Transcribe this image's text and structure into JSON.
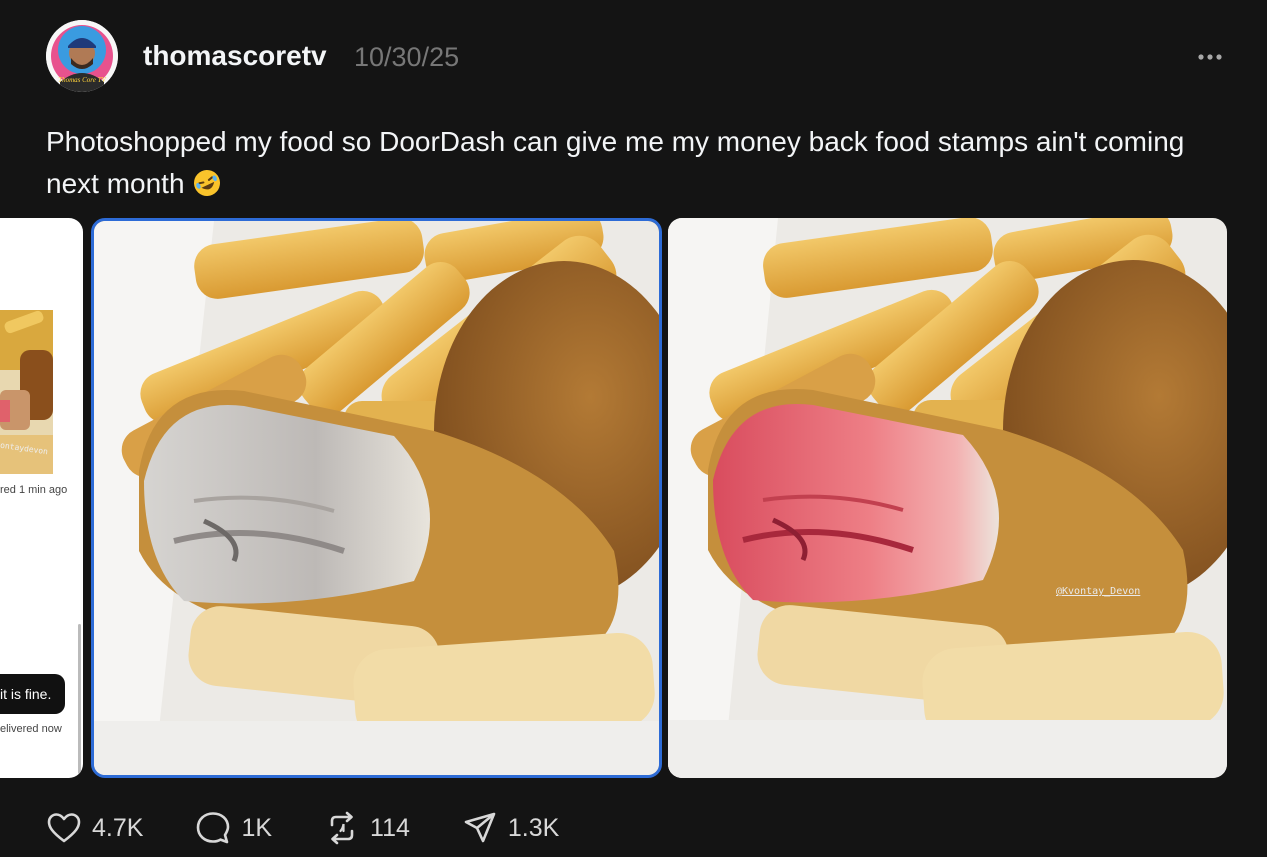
{
  "post": {
    "username": "thomascoretv",
    "timestamp": "10/30/25",
    "caption": "Photoshopped my food so DoorDash can give me my money back food stamps ain't coming next month",
    "caption_emoji": "rolling-on-the-floor-laughing-emoji",
    "avatar_text": "Thomas Core TV",
    "menu_icon": "more-options-icon"
  },
  "media": {
    "screenshot_card": {
      "meta_text": "red 1 min ago",
      "bubble_text": "it is fine.",
      "status_text": "elivered now",
      "watermark": "ontaydevon"
    },
    "edited_photo": {
      "watermark": "@Kvontay_Devon"
    },
    "selected_index": 1
  },
  "actions": {
    "likes": "4.7K",
    "comments": "1K",
    "reposts": "114",
    "shares": "1.3K",
    "icons": [
      "heart-icon",
      "comment-icon",
      "repost-icon",
      "share-icon"
    ]
  },
  "colors": {
    "background": "#141414",
    "text": "#f3f5f7",
    "muted": "#777777",
    "selection_border": "#2d6bd6"
  }
}
